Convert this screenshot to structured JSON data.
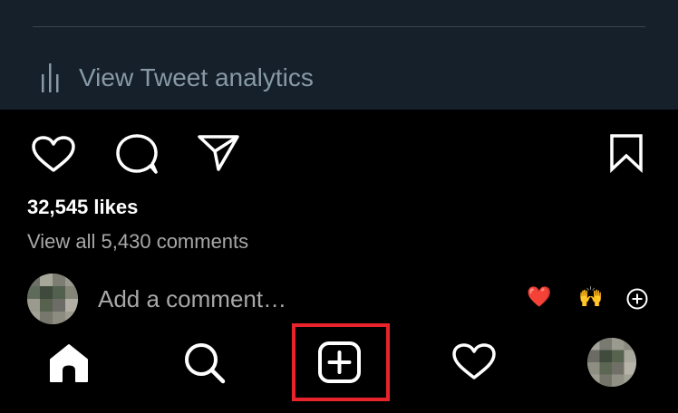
{
  "tweet": {
    "analytics_label": "View Tweet analytics"
  },
  "post": {
    "likes_text": "32,545 likes",
    "view_comments_text": "View all 5,430 comments",
    "comment_placeholder": "Add a comment…",
    "quick_reactions": [
      "❤️",
      "🙌"
    ]
  },
  "icons": {
    "analytics": "bar-chart-icon",
    "like": "heart-outline-icon",
    "comment": "speech-bubble-icon",
    "share": "paper-plane-icon",
    "save": "bookmark-icon",
    "add_reaction": "plus-circle-icon",
    "nav_home": "home-icon",
    "nav_search": "search-icon",
    "nav_create": "plus-square-icon",
    "nav_activity": "heart-outline-icon",
    "nav_profile": "avatar"
  },
  "colors": {
    "tweet_background": "#15202b",
    "app_background": "#000000",
    "highlight_border": "#e8232b",
    "muted_text": "#a8a8a8",
    "tweet_muted_text": "#8899a6"
  }
}
